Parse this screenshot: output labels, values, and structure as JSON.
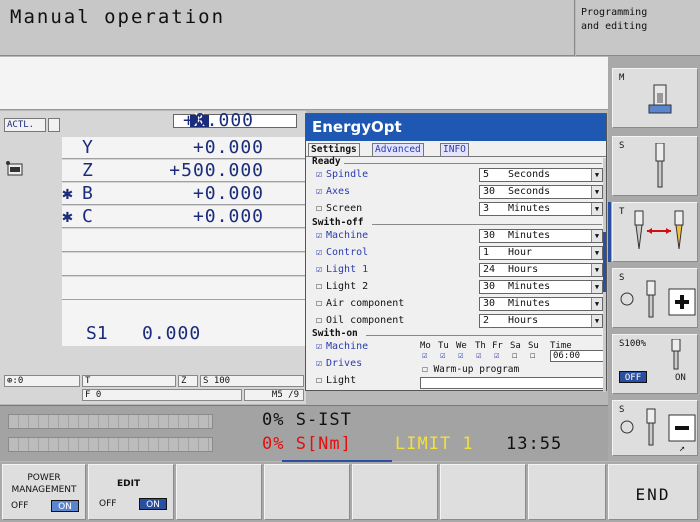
{
  "header": {
    "mode_title": "Manual operation",
    "mode2_line1": "Programming",
    "mode2_line2": "and editing"
  },
  "position": {
    "actl_label": "ACTL.",
    "axes": [
      {
        "star": "",
        "name": "X",
        "value": "+0.000"
      },
      {
        "star": "",
        "name": "Y",
        "value": "+0.000"
      },
      {
        "star": "",
        "name": "Z",
        "value": "+500.000"
      },
      {
        "star": "✱",
        "name": "B",
        "value": "+0.000"
      },
      {
        "star": "✱",
        "name": "C",
        "value": "+0.000"
      }
    ],
    "spindle_name": "S1",
    "spindle_value": "0.000"
  },
  "status": {
    "p": "⊕:0",
    "t": "T",
    "z": "Z",
    "s": "S 100",
    "f": "F 0",
    "m": "M5 /9"
  },
  "dialog": {
    "title": "EnergyOpt",
    "tabs": [
      "Settings",
      "Advanced",
      "INFO"
    ],
    "ready_label": "Ready",
    "ready": [
      {
        "label": "Spindle",
        "checked": true,
        "num": "5",
        "unit": "Seconds"
      },
      {
        "label": "Axes",
        "checked": true,
        "num": "30",
        "unit": "Seconds"
      },
      {
        "label": "Screen",
        "checked": false,
        "num": "3",
        "unit": "Minutes"
      }
    ],
    "switchoff_label": "Swith-off",
    "switchoff": [
      {
        "label": "Machine",
        "checked": true,
        "num": "30",
        "unit": "Minutes"
      },
      {
        "label": "Control",
        "checked": true,
        "num": "1",
        "unit": "Hour"
      },
      {
        "label": "Light 1",
        "checked": true,
        "num": "24",
        "unit": "Hours"
      },
      {
        "label": "Light 2",
        "checked": false,
        "num": "30",
        "unit": "Minutes"
      },
      {
        "label": "Air component",
        "checked": false,
        "num": "30",
        "unit": "Minutes"
      },
      {
        "label": "Oil component",
        "checked": false,
        "num": "2",
        "unit": "Hours"
      }
    ],
    "switchon_label": "Swith-on",
    "switchon": [
      {
        "label": "Machine",
        "checked": true
      },
      {
        "label": "Drives",
        "checked": true
      },
      {
        "label": "Light",
        "checked": false
      }
    ],
    "days": [
      "Mo",
      "Tu",
      "We",
      "Th",
      "Fr",
      "Sa",
      "Su"
    ],
    "time_label": "Time",
    "time_value": "06:00",
    "warmup_label": "Warm-up program"
  },
  "load": {
    "line1": "0% S-IST",
    "line2a": "0% S[Nm]",
    "line2b": "LIMIT 1",
    "line2c": "13:55"
  },
  "softkeys_right": {
    "m": "M",
    "s": "S",
    "t": "T",
    "s2": "S",
    "s100": "S100%",
    "off": "OFF",
    "on": "ON",
    "s3": "S"
  },
  "softkeys_bottom": {
    "power1": "POWER",
    "power2": "MANAGEMENT",
    "power_off": "OFF",
    "power_on": "ON",
    "edit": "EDIT",
    "edit_off": "OFF",
    "edit_on": "ON",
    "end": "END"
  }
}
